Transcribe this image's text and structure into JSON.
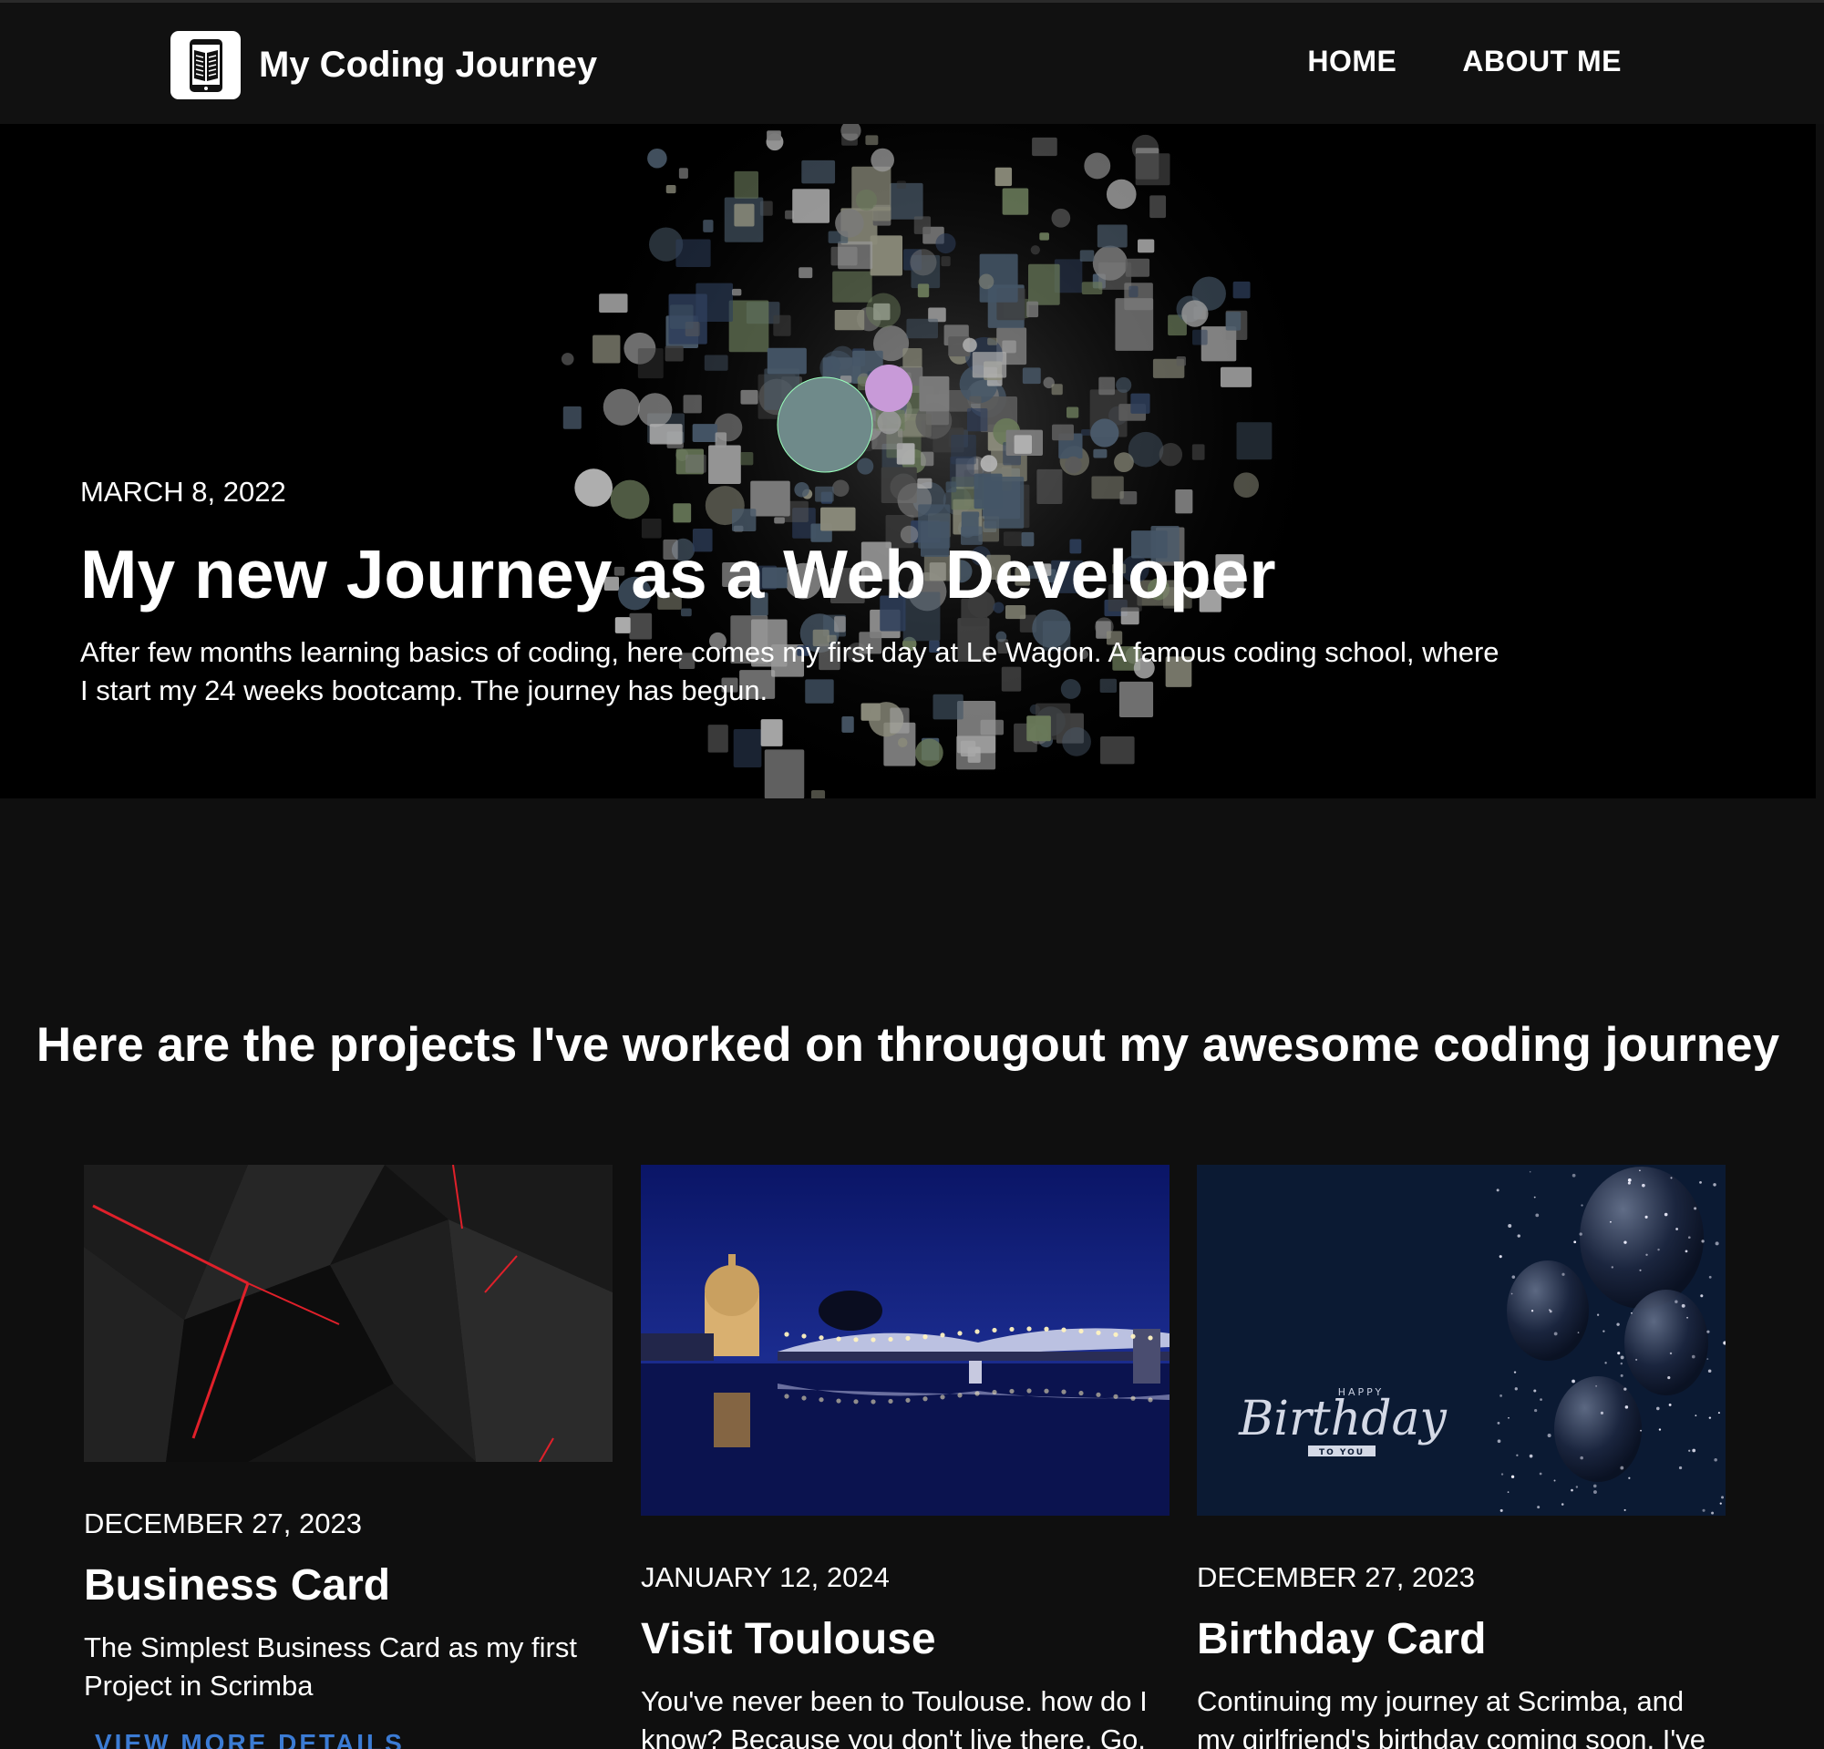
{
  "nav": {
    "brand": "My Coding Journey",
    "links": [
      "HOME",
      "ABOUT ME"
    ]
  },
  "hero": {
    "date": "MARCH 8, 2022",
    "title": "My new Journey as a Web Developer",
    "text": "After few months learning basics of coding, here comes my first day at Le Wagon. A famous coding school, where I start my 24 weeks bootcamp. The journey has begun."
  },
  "projects": {
    "heading": "Here are the projects I've worked on througout my awesome coding journey",
    "cards": [
      {
        "date": "DECEMBER 27, 2023",
        "title": "Business Card",
        "text": "The Simplest Business Card as my first Project in Scrimba",
        "link": "VIEW MORE DETAILS"
      },
      {
        "date": "JANUARY 12, 2024",
        "title": "Visit Toulouse",
        "text": "You've never been to Toulouse. how do I know? Because you don't live there. Go,"
      },
      {
        "date": "DECEMBER 27, 2023",
        "title": "Birthday Card",
        "text": "Continuing my journey at Scrimba, and my girlfriend's birthday coming soon, I've"
      }
    ]
  },
  "birthday_graphic": {
    "small_top": "HAPPY",
    "script": "Birthday",
    "small_bottom": "TO YOU"
  },
  "colors": {
    "background": "#0f0f0f",
    "nav": "#111111",
    "link": "#3b7bd4",
    "accent_red": "#e0202a",
    "night_blue": "#0d1a5c"
  },
  "icons": {
    "logo": "book-phone-icon"
  }
}
